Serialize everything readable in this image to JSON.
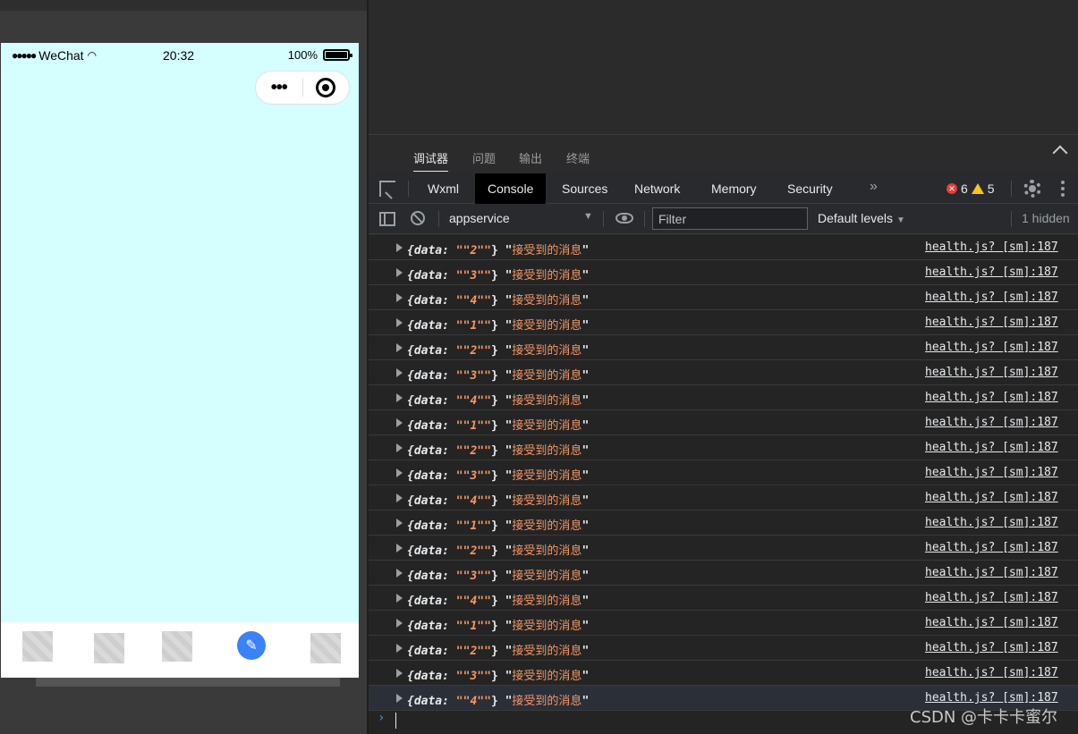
{
  "phone": {
    "carrier": "WeChat",
    "signal_dots": "●●●●●",
    "time": "20:32",
    "battery": "100%",
    "capsule_more": "•••"
  },
  "panel_tabs": [
    "调试器",
    "问题",
    "输出",
    "终端"
  ],
  "devtools_tabs": [
    "Wxml",
    "Console",
    "Sources",
    "Network",
    "Memory",
    "Security"
  ],
  "devtools_more": "»",
  "errors": "6",
  "warnings": "5",
  "context": "appservice",
  "filter_placeholder": "Filter",
  "levels": "Default levels",
  "hidden": "1 hidden",
  "log_key": "{data: ",
  "log_message": "接受到的消息",
  "log_source": "health.js? [sm]:187",
  "log_values": [
    "2",
    "3",
    "4",
    "1",
    "2",
    "3",
    "4",
    "1",
    "2",
    "3",
    "4",
    "1",
    "2",
    "3",
    "4",
    "1",
    "2",
    "3",
    "4"
  ],
  "prompt": "›",
  "watermark": "CSDN @卡卡卡蜜尔"
}
